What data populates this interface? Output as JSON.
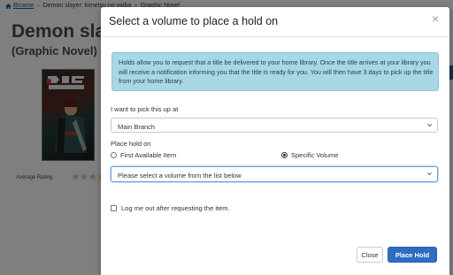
{
  "breadcrumb": {
    "home": "Browse",
    "items": [
      "Demon slayer: kimetsu no yaiba",
      "Graphic Novel"
    ]
  },
  "page": {
    "title": "Demon slay",
    "subtitle": "(Graphic Novel)",
    "average_rating_label": "Average Rating",
    "stars": "★★★★★"
  },
  "modal": {
    "title": "Select a volume to place a hold on",
    "close_icon": "×",
    "info": "Holds allow you to request that a title be delivered to your home library. Once the title arrives at your library you will receive a notification informing you that the title is ready for you. You will then have 3 days to pick up the title from your home library.",
    "pickup_label": "I want to pick this up at",
    "pickup_value": "Main Branch",
    "hold_on_label": "Place hold on",
    "options": [
      {
        "label": "First Available Item",
        "selected": false
      },
      {
        "label": "Specific Volume",
        "selected": true
      }
    ],
    "volume_placeholder": "Please select a volume from the list below",
    "logout_label": "Log me out after requesting the item.",
    "close_button": "Close",
    "hold_button": "Place Hold"
  },
  "colors": {
    "info_bg": "#a8d7e5",
    "primary_button": "#2f6cc4",
    "link": "#1a5c9e"
  }
}
